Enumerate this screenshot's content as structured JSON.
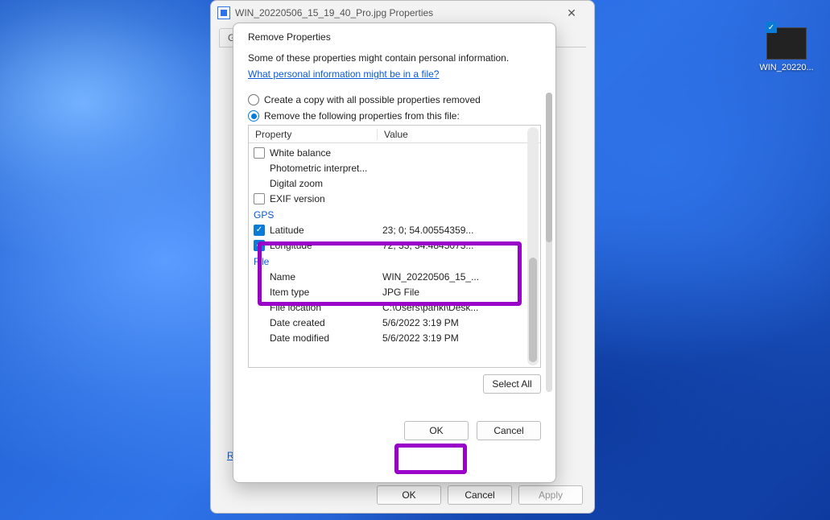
{
  "desktop": {
    "file_label": "WIN_20220..."
  },
  "parent": {
    "title": "WIN_20220506_15_19_40_Pro.jpg Properties",
    "tab_general": "Ge",
    "remove_link_trunc": "R",
    "ok": "OK",
    "cancel": "Cancel",
    "apply": "Apply"
  },
  "dialog": {
    "title": "Remove Properties",
    "intro": "Some of these properties might contain personal information.",
    "help_link": "What personal information might be in a file?",
    "radio_copy": "Create a copy with all possible properties removed",
    "radio_remove": "Remove the following properties from this file:",
    "col_property": "Property",
    "col_value": "Value",
    "rows": {
      "white_balance": "White balance",
      "photometric": "Photometric interpret...",
      "digital_zoom": "Digital zoom",
      "exif_version": "EXIF version"
    },
    "gps_group": "GPS",
    "gps": {
      "latitude_label": "Latitude",
      "latitude_value": "23; 0; 54.00554359...",
      "longitude_label": "Longitude",
      "longitude_value": "72; 33; 34.4845073..."
    },
    "file_group": "File",
    "file": {
      "name_label": "Name",
      "name_value": "WIN_20220506_15_...",
      "type_label": "Item type",
      "type_value": "JPG File",
      "location_label": "File location",
      "location_value": "C:\\Users\\panki\\Desk...",
      "created_label": "Date created",
      "created_value": "5/6/2022 3:19 PM",
      "modified_label": "Date modified",
      "modified_value": "5/6/2022 3:19 PM"
    },
    "select_all": "Select All",
    "ok": "OK",
    "cancel": "Cancel"
  }
}
